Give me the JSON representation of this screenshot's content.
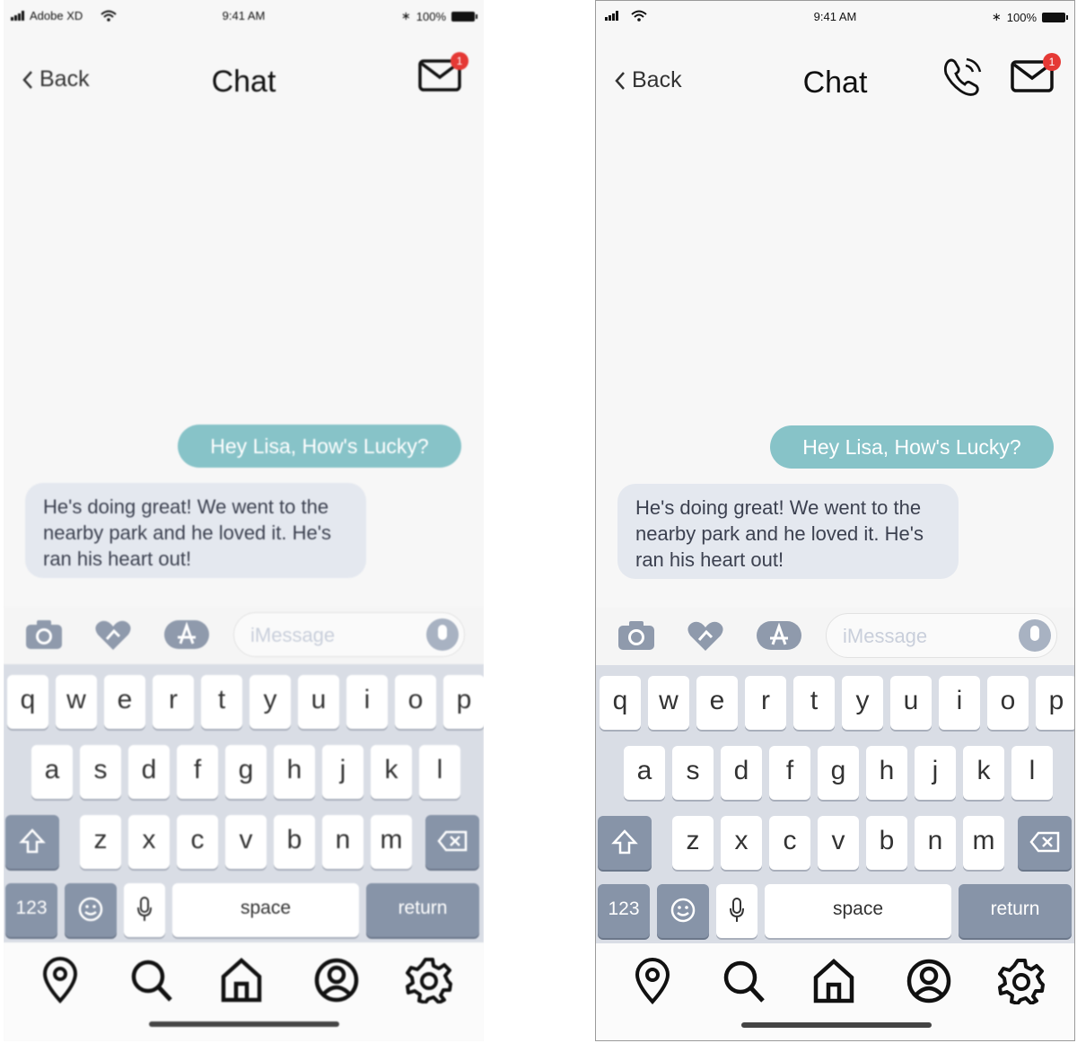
{
  "left_screen": {
    "status": {
      "carrier": "Adobe XD",
      "time": "9:41 AM",
      "battery": "100%"
    },
    "nav": {
      "back_label": "Back",
      "title": "Chat",
      "mail_badge": "1"
    },
    "messages": {
      "outgoing": "Hey Lisa, How's Lucky?",
      "incoming": "He's doing great! We went to the nearby park and he loved it. He's ran his heart out!"
    },
    "input": {
      "placeholder": "iMessage"
    },
    "keyboard": {
      "row1": [
        "q",
        "w",
        "e",
        "r",
        "t",
        "y",
        "u",
        "i",
        "o",
        "p"
      ],
      "row2": [
        "a",
        "s",
        "d",
        "f",
        "g",
        "h",
        "j",
        "k",
        "l"
      ],
      "row3": [
        "z",
        "x",
        "c",
        "v",
        "b",
        "n",
        "m"
      ],
      "numbers_label": "123",
      "space_label": "space",
      "return_label": "return"
    }
  },
  "right_screen": {
    "status": {
      "time": "9:41 AM",
      "battery": "100%"
    },
    "nav": {
      "back_label": "Back",
      "title": "Chat",
      "mail_badge": "1"
    },
    "messages": {
      "outgoing": "Hey Lisa, How's Lucky?",
      "incoming": "He's doing great! We went to the nearby park and he loved it. He's ran his heart out!"
    },
    "input": {
      "placeholder": "iMessage"
    },
    "keyboard": {
      "row1": [
        "q",
        "w",
        "e",
        "r",
        "t",
        "y",
        "u",
        "i",
        "o",
        "p"
      ],
      "row2": [
        "a",
        "s",
        "d",
        "f",
        "g",
        "h",
        "j",
        "k",
        "l"
      ],
      "row3": [
        "z",
        "x",
        "c",
        "v",
        "b",
        "n",
        "m"
      ],
      "numbers_label": "123",
      "space_label": "space",
      "return_label": "return"
    }
  },
  "icons": {
    "toolbar": [
      "camera-icon",
      "heart-sticker-icon",
      "app-store-icon",
      "microphone-icon"
    ],
    "tabbar": [
      "location-pin-icon",
      "search-icon",
      "home-icon",
      "profile-icon",
      "settings-gear-icon"
    ]
  },
  "colors": {
    "outgoing_bubble": "#87c3c8",
    "incoming_bubble": "#e4e8ef",
    "keyboard_dark_key": "#8794a8",
    "badge": "#e53935"
  }
}
